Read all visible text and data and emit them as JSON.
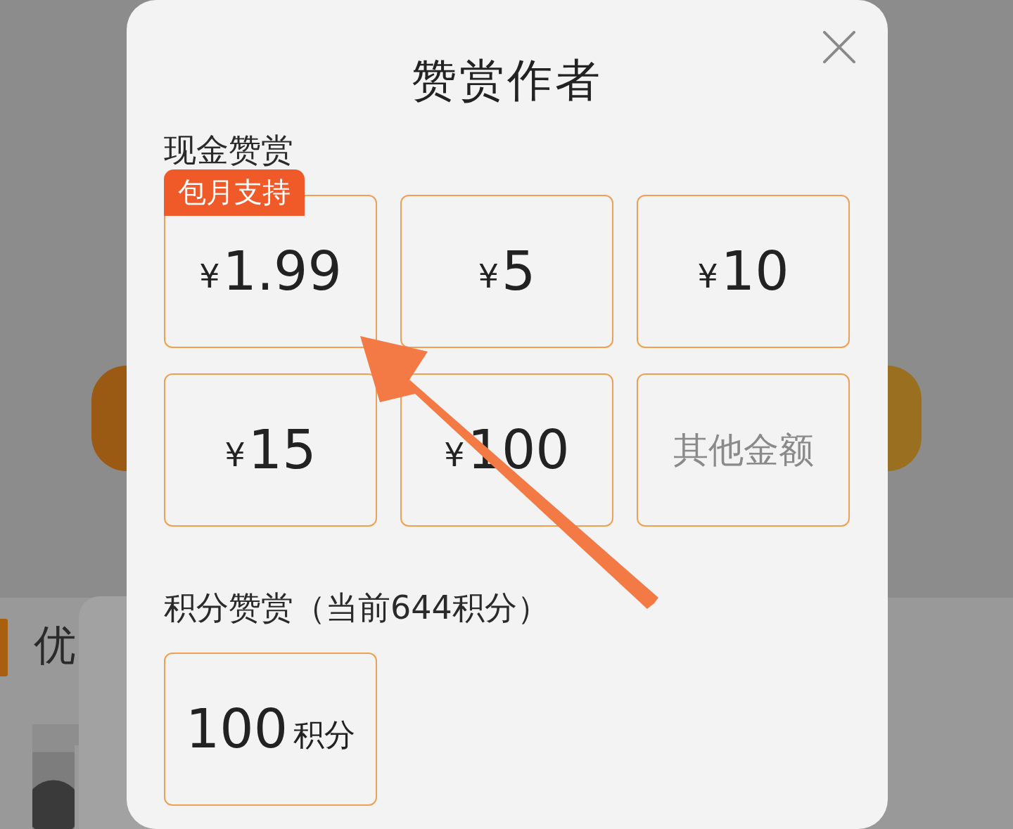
{
  "background": {
    "section_title": "优"
  },
  "dialog": {
    "title": "赞赏作者",
    "cash_section": {
      "label": "现金赞赏",
      "badge": "包月支持",
      "options": [
        {
          "kind": "amount",
          "symbol": "¥",
          "value": "1.99"
        },
        {
          "kind": "amount",
          "symbol": "¥",
          "value": "5"
        },
        {
          "kind": "amount",
          "symbol": "¥",
          "value": "10"
        },
        {
          "kind": "amount",
          "symbol": "¥",
          "value": "15"
        },
        {
          "kind": "amount",
          "symbol": "¥",
          "value": "100"
        },
        {
          "kind": "other",
          "label": "其他金额"
        }
      ]
    },
    "points_section": {
      "label": "积分赞赏（当前644积分）",
      "options": [
        {
          "value": "100",
          "unit": "积分"
        }
      ]
    }
  }
}
